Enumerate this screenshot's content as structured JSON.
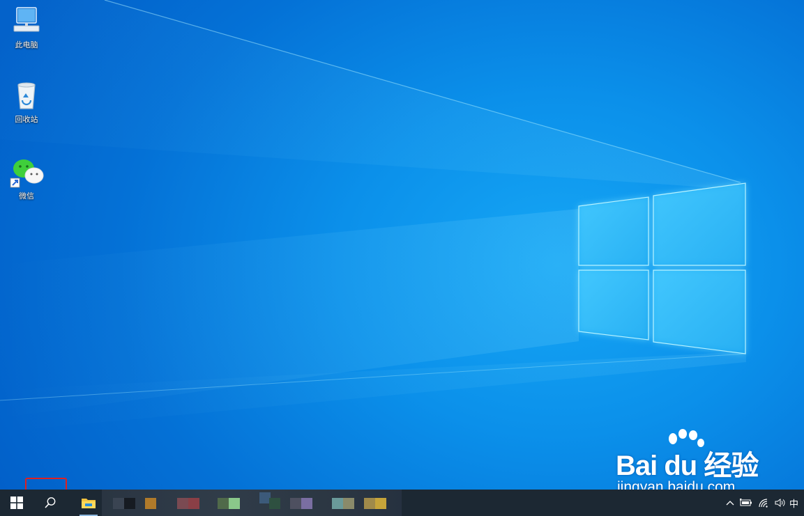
{
  "desktop": {
    "icons": [
      {
        "label": "此电脑",
        "icon": "this-pc-icon"
      },
      {
        "label": "回收站",
        "icon": "recycle-bin-icon"
      },
      {
        "label": "微信",
        "icon": "wechat-icon",
        "shortcut": true
      }
    ],
    "wallpaper": "windows-10-hero-light",
    "colors": {
      "wallpaper_mid": "#0b90ea",
      "wallpaper_edge": "#0260c9",
      "highlight": "#e02020"
    }
  },
  "watermark": {
    "brand": "Bai du 经验",
    "url": "jingyan.baidu.com"
  },
  "taskbar": {
    "start_icon": "windows-logo-icon",
    "search_icon": "search-icon",
    "search_highlighted": true,
    "explorer_icon": "file-explorer-icon",
    "tray": {
      "ime": "中",
      "icons": [
        "chevron-up-icon",
        "battery-icon",
        "wifi-icon",
        "volume-icon"
      ]
    },
    "colors": {
      "background": "#1c2833"
    }
  }
}
